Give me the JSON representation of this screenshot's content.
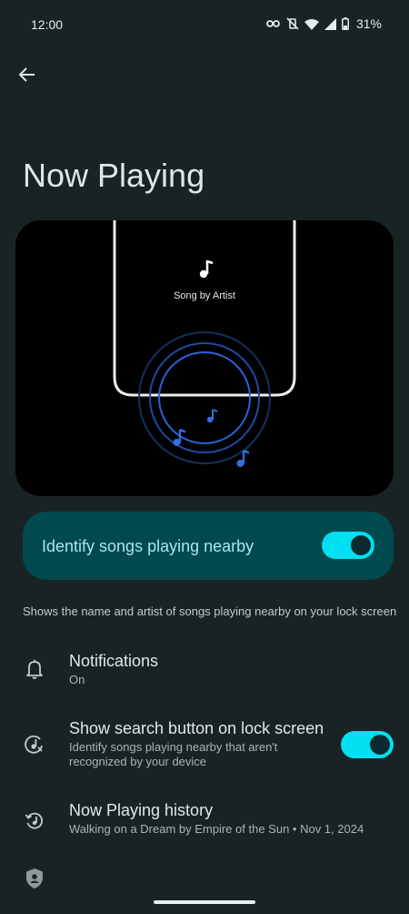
{
  "status_bar": {
    "time": "12:00",
    "battery_percent": "31%",
    "icons": [
      "vpn-key-icon",
      "vibrate-off-icon",
      "wifi-icon",
      "signal-icon",
      "battery-icon"
    ]
  },
  "header": {
    "back_icon": "arrow-back-icon",
    "title": "Now Playing"
  },
  "illustration": {
    "caption": "Song by Artist",
    "icons": [
      "music-note-icon"
    ]
  },
  "main_switch": {
    "label": "Identify songs playing nearby",
    "enabled": true
  },
  "description": "Shows the name and artist of songs playing nearby on your lock screen",
  "settings": [
    {
      "icon": "bell-icon",
      "title": "Notifications",
      "subtitle": "On"
    },
    {
      "icon": "music-search-icon",
      "title": "Show search button on lock screen",
      "subtitle_line1": "Identify songs playing nearby that aren't",
      "subtitle_line2": "recognized by your device",
      "enabled": true
    },
    {
      "icon": "history-icon",
      "title": "Now Playing history",
      "subtitle": "Walking on a Dream by Empire of the Sun • Nov 1, 2024"
    },
    {
      "icon": "privacy-shield-icon"
    }
  ],
  "colors": {
    "background": "#192324",
    "accent": "#00e0f0",
    "switch_card": "#00494f",
    "note_blue": "#2f6fe0"
  }
}
